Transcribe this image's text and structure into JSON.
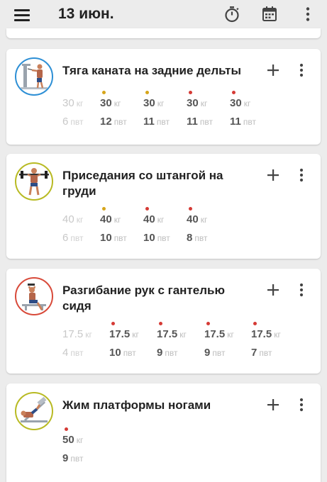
{
  "header": {
    "date": "13 июн.",
    "icons": [
      "menu-icon",
      "timer-icon",
      "calendar-icon",
      "overflow-icon"
    ]
  },
  "colors": {
    "dot_yellow": "#d6a51a",
    "dot_red": "#d53a35",
    "ring_blue": "#2d8fd5",
    "ring_olive": "#b8ba23",
    "ring_red": "#d84a3a"
  },
  "exercises": [
    {
      "name": "Тяга каната на задние дельты",
      "ring": "blue",
      "sets": [
        {
          "weight": "30",
          "unit": "кг",
          "reps": "6",
          "reps_unit": "пвт",
          "type": "warmup",
          "dot": ""
        },
        {
          "weight": "30",
          "unit": "кг",
          "reps": "12",
          "reps_unit": "пвт",
          "type": "work",
          "dot": "yellow"
        },
        {
          "weight": "30",
          "unit": "кг",
          "reps": "11",
          "reps_unit": "пвт",
          "type": "work",
          "dot": "yellow"
        },
        {
          "weight": "30",
          "unit": "кг",
          "reps": "11",
          "reps_unit": "пвт",
          "type": "work",
          "dot": "red"
        },
        {
          "weight": "30",
          "unit": "кг",
          "reps": "11",
          "reps_unit": "пвт",
          "type": "work",
          "dot": "red"
        }
      ]
    },
    {
      "name": "Приседания со штангой на груди",
      "ring": "olive",
      "sets": [
        {
          "weight": "40",
          "unit": "кг",
          "reps": "6",
          "reps_unit": "пвт",
          "type": "warmup",
          "dot": ""
        },
        {
          "weight": "40",
          "unit": "кг",
          "reps": "10",
          "reps_unit": "пвт",
          "type": "work",
          "dot": "yellow"
        },
        {
          "weight": "40",
          "unit": "кг",
          "reps": "10",
          "reps_unit": "пвт",
          "type": "work",
          "dot": "red"
        },
        {
          "weight": "40",
          "unit": "кг",
          "reps": "8",
          "reps_unit": "пвт",
          "type": "work",
          "dot": "red"
        }
      ]
    },
    {
      "name": "Разгибание рук с гантелью сидя",
      "ring": "red",
      "sets": [
        {
          "weight": "17.5",
          "unit": "кг",
          "reps": "4",
          "reps_unit": "пвт",
          "type": "warmup",
          "dot": ""
        },
        {
          "weight": "17.5",
          "unit": "кг",
          "reps": "10",
          "reps_unit": "пвт",
          "type": "work",
          "dot": "red"
        },
        {
          "weight": "17.5",
          "unit": "кг",
          "reps": "9",
          "reps_unit": "пвт",
          "type": "work",
          "dot": "red"
        },
        {
          "weight": "17.5",
          "unit": "кг",
          "reps": "9",
          "reps_unit": "пвт",
          "type": "work",
          "dot": "red"
        },
        {
          "weight": "17.5",
          "unit": "кг",
          "reps": "7",
          "reps_unit": "пвт",
          "type": "work",
          "dot": "red"
        }
      ]
    },
    {
      "name": "Жим платформы ногами",
      "ring": "olive",
      "sets": [
        {
          "weight": "50",
          "unit": "кг",
          "reps": "9",
          "reps_unit": "пвт",
          "type": "work",
          "dot": "red"
        }
      ]
    }
  ]
}
